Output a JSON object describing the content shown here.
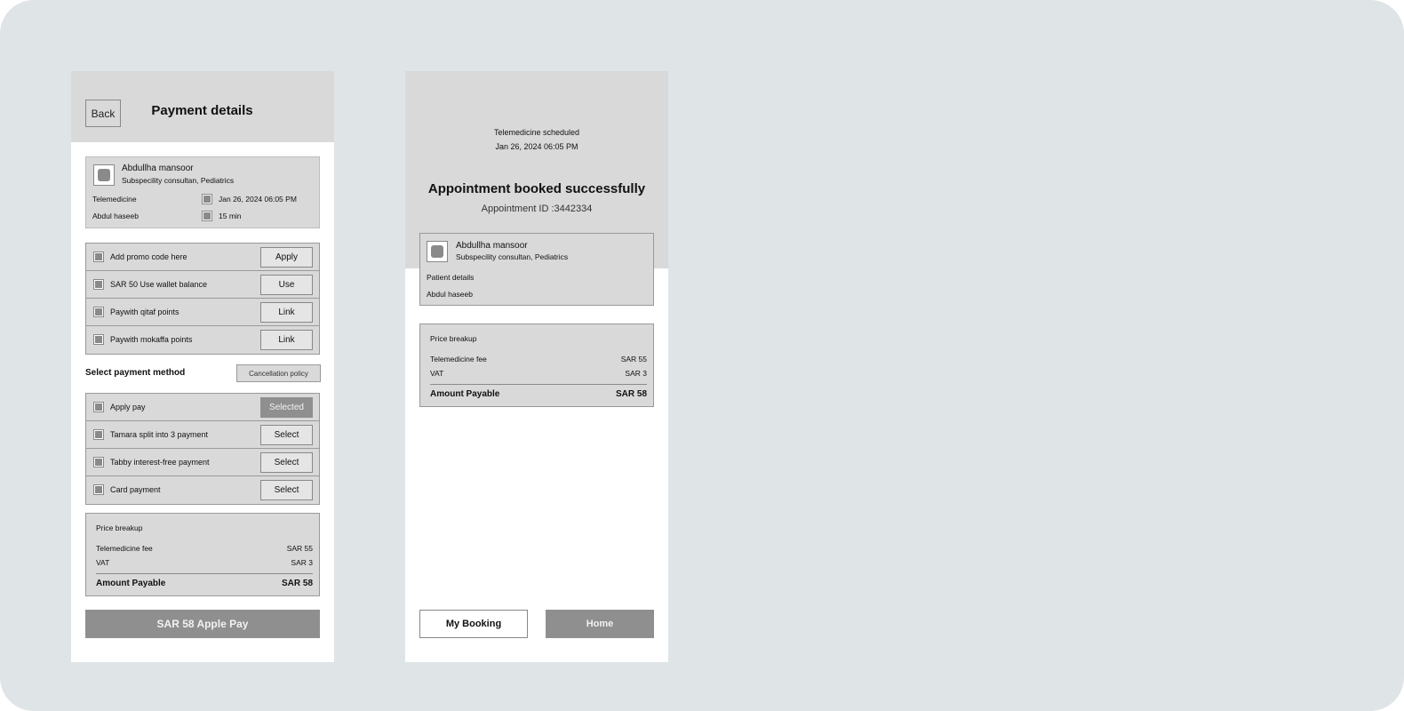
{
  "payment_screen": {
    "back_label": "Back",
    "title": "Payment details",
    "doctor": {
      "name": "Abdullha mansoor",
      "specialty": "Subspecility consultan, Pediatrics",
      "consult_type": "Telemedicine",
      "date_time": "Jan 26, 2024  06:05 PM",
      "patient": "Abdul haseeb",
      "duration": "15 min"
    },
    "offers": [
      {
        "label": "Add promo code here",
        "action": "Apply"
      },
      {
        "label": "SAR 50 Use wallet balance",
        "action": "Use"
      },
      {
        "label": "Paywith qitaf points",
        "action": "Link"
      },
      {
        "label": "Paywith mokaffa points",
        "action": "Link"
      }
    ],
    "select_payment_label": "Select payment method",
    "cancellation_policy_label": "Cancellation policy",
    "methods": [
      {
        "label": "Apply pay",
        "action": "Selected",
        "selected": true
      },
      {
        "label": "Tamara split into 3 payment",
        "action": "Select",
        "selected": false
      },
      {
        "label": "Tabby interest-free payment",
        "action": "Select",
        "selected": false
      },
      {
        "label": "Card payment",
        "action": "Select",
        "selected": false
      }
    ],
    "price": {
      "title": "Price breakup",
      "fee_label": "Telemedicine fee",
      "fee_value": "SAR 55",
      "vat_label": "VAT",
      "vat_value": "SAR 3",
      "total_label": "Amount Payable",
      "total_value": "SAR 58"
    },
    "pay_button": "SAR 58 Apple Pay"
  },
  "success_screen": {
    "status": "Telemedicine scheduled",
    "date_time": "Jan 26, 2024  06:05 PM",
    "title": "Appointment booked successfully",
    "appointment_id": "Appointment ID :3442334",
    "doctor": {
      "name": "Abdullha mansoor",
      "specialty": "Subspecility consultan, Pediatrics"
    },
    "patient_details_label": "Patient details",
    "patient_name": "Abdul haseeb",
    "price": {
      "title": "Price breakup",
      "fee_label": "Telemedicine fee",
      "fee_value": "SAR 55",
      "vat_label": "VAT",
      "vat_value": "SAR 3",
      "total_label": "Amount Payable",
      "total_value": "SAR 58"
    },
    "my_booking_button": "My Booking",
    "home_button": "Home"
  }
}
